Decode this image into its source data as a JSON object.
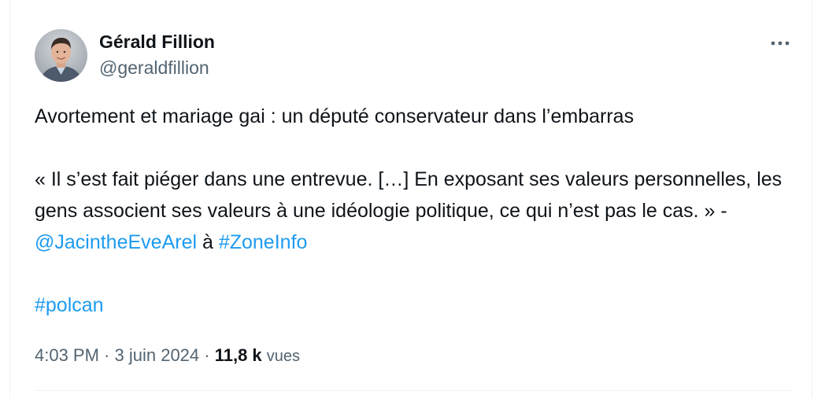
{
  "tweet": {
    "author": {
      "display_name": "Gérald Fillion",
      "handle": "@geraldfillion"
    },
    "text": {
      "line1": "Avortement et mariage gai : un député conservateur dans l’embarras",
      "quote": "« Il s’est fait piéger dans une entrevue. […] En exposant ses valeurs personnelles, les gens associent ses valeurs à une idéologie politique, ce qui n’est pas le cas. » - ",
      "mention": "@JacintheEveArel",
      "connector": " à ",
      "hashtag_zoneinfo": "#ZoneInfo",
      "hashtag_polcan": "#polcan"
    },
    "meta": {
      "time": "4:03 PM",
      "separator1": " · ",
      "date": "3 juin 2024",
      "separator2": " · ",
      "views_count": "11,8 k",
      "views_label": "vues"
    }
  },
  "icons": {
    "more": "more-horizontal-icon",
    "avatar": "profile-photo"
  },
  "colors": {
    "link": "#1d9bf0",
    "secondary_text": "#536471",
    "primary_text": "#0f1419",
    "divider": "#eff3f4"
  }
}
